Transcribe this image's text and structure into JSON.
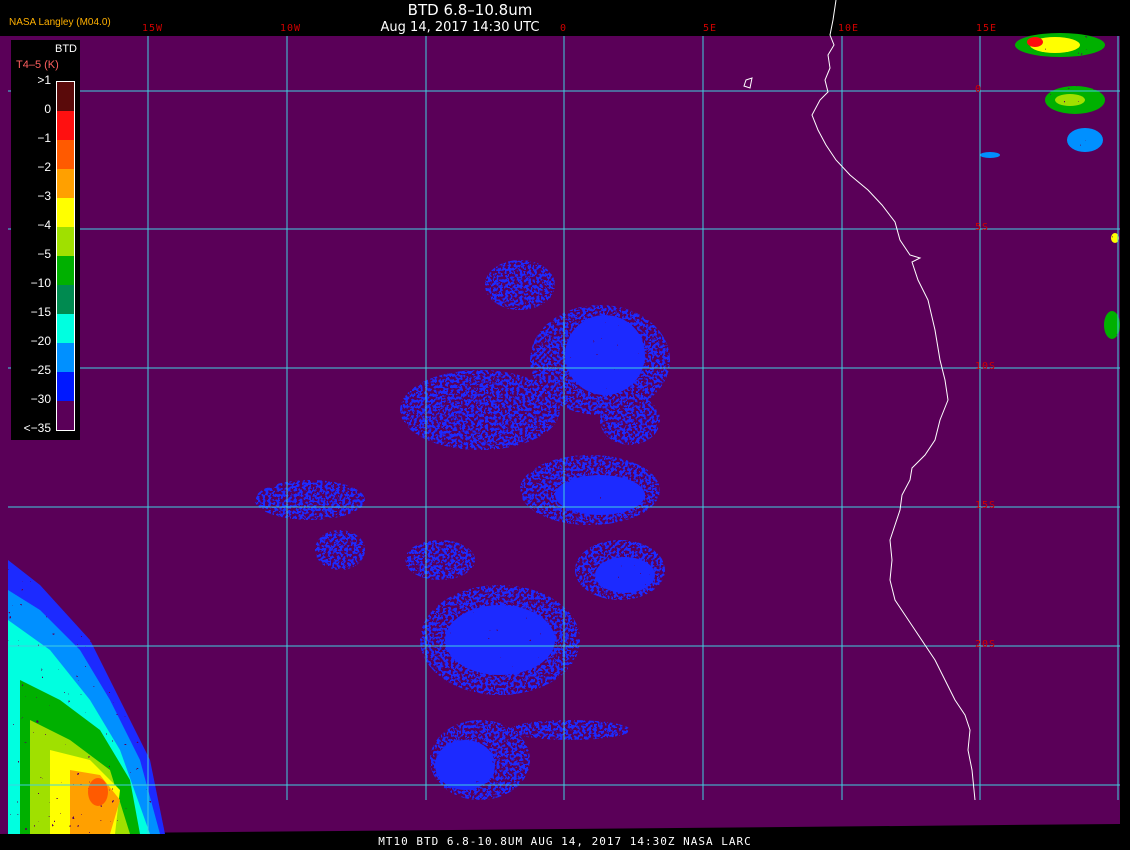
{
  "header": {
    "brand": "NASA Langley (M04.0)",
    "title": "BTD 6.8–10.8um",
    "subtitle": "Aug 14, 2017 14:30 UTC"
  },
  "grid": {
    "lon_labels": [
      "15W",
      "10W",
      "0",
      "5E",
      "10E",
      "15E"
    ],
    "lat_labels": [
      "0",
      "5S",
      "10S",
      "15S",
      "20S"
    ]
  },
  "legend": {
    "heading": "BTD",
    "subheading": "T4–5 (K)",
    "ticks": [
      ">1",
      "0",
      "−1",
      "−2",
      "−3",
      "−4",
      "−5",
      "−10",
      "−15",
      "−20",
      "−25",
      "−30",
      "<−35"
    ],
    "colors": [
      "#5a0a0a",
      "#ff1010",
      "#ff5a00",
      "#ffa000",
      "#ffff00",
      "#a0e000",
      "#00b000",
      "#008a50",
      "#00ffe0",
      "#0090ff",
      "#0018ff",
      "#5a0058"
    ]
  },
  "colors": {
    "background": "#5a0058",
    "grid_line": "#40d0e0",
    "coastline": "#ffffff",
    "cloud_primary": "#1a2cff"
  },
  "footer": {
    "text": "MT10  BTD 6.8-10.8UM   AUG 14, 2017  14:30Z   NASA LARC"
  }
}
